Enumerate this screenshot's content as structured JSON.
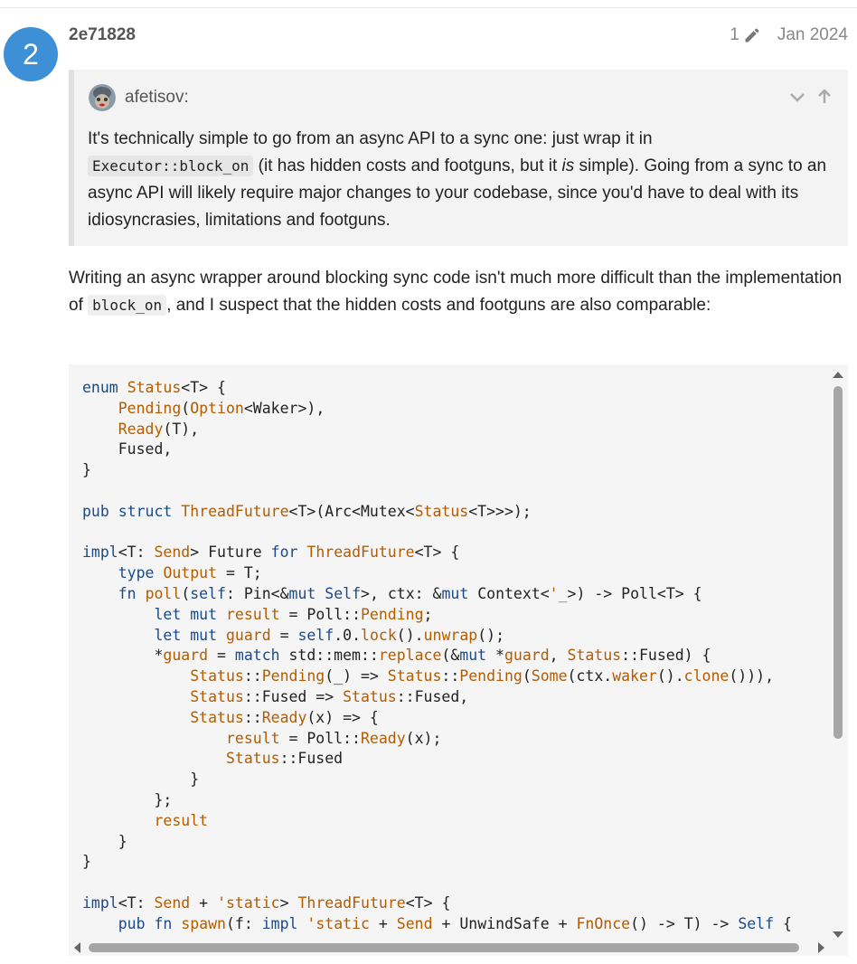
{
  "post": {
    "number": "2",
    "author": "2e71828",
    "edit_count": "1",
    "date": "Jan 2024",
    "accent_color": "#3d8fd6"
  },
  "quote": {
    "user": "afetisov:",
    "text_1": "It's technically simple to go from an async API to a sync one: just wrap it in",
    "code_1": "Executor::block_on",
    "text_2": " (it has hidden costs and footguns, but it ",
    "em_1": "is",
    "text_3": " simple). Going from a sync to an async API will likely require major changes to your codebase, since you'd have to deal with its idiosyncrasies, limitations and footguns."
  },
  "body": {
    "text_1": "Writing an async wrapper around blocking sync code isn't much more difficult than the implementation of ",
    "code_1": "block_on",
    "text_2": ", and I suspect that the hidden costs and footguns are also comparable:"
  },
  "code": {
    "lines": [
      "enum Status<T> {",
      "    Pending(Option<Waker>),",
      "    Ready(T),",
      "    Fused,",
      "}",
      "",
      "pub struct ThreadFuture<T>(Arc<Mutex<Status<T>>>);",
      "",
      "impl<T: Send> Future for ThreadFuture<T> {",
      "    type Output = T;",
      "    fn poll(self: Pin<&mut Self>, ctx: &mut Context<'_>) -> Poll<T> {",
      "        let mut result = Poll::Pending;",
      "        let mut guard = self.0.lock().unwrap();",
      "        *guard = match std::mem::replace(&mut *guard, Status::Fused) {",
      "            Status::Pending(_) => Status::Pending(Some(ctx.waker().clone())),",
      "            Status::Fused => Status::Fused,",
      "            Status::Ready(x) => {",
      "                result = Poll::Ready(x);",
      "                Status::Fused",
      "            }",
      "        };",
      "        result",
      "    }",
      "}",
      "",
      "impl<T: Send + 'static> ThreadFuture<T> {",
      "    pub fn spawn(f: impl 'static + Send + UnwindSafe + FnOnce() -> T) -> Self {"
    ]
  },
  "icons": {
    "edit": "pencil-icon",
    "collapse": "chevron-down-icon",
    "go_to_quote": "arrow-up-icon"
  }
}
